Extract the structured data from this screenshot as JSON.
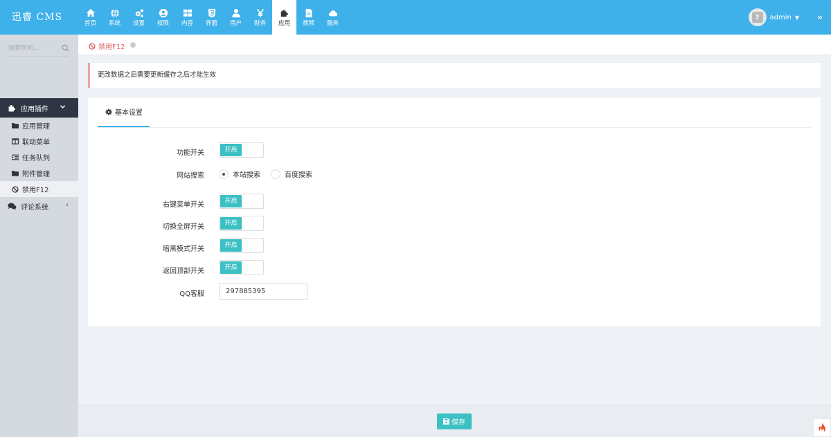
{
  "app": {
    "logo": "迅睿 CMS"
  },
  "topnav": [
    {
      "label": "首页",
      "icon": "home-icon"
    },
    {
      "label": "系统",
      "icon": "globe-icon"
    },
    {
      "label": "设置",
      "icon": "cogs-icon"
    },
    {
      "label": "权限",
      "icon": "user-circle-icon"
    },
    {
      "label": "内容",
      "icon": "table-icon"
    },
    {
      "label": "界面",
      "icon": "html5-icon"
    },
    {
      "label": "用户",
      "icon": "user-icon"
    },
    {
      "label": "财务",
      "icon": "yen-icon"
    },
    {
      "label": "应用",
      "icon": "puzzle-icon",
      "active": true
    },
    {
      "label": "视频",
      "icon": "file-icon"
    },
    {
      "label": "服务",
      "icon": "cloud-icon"
    }
  ],
  "user": {
    "name": "admin"
  },
  "sidebar": {
    "search_placeholder": "搜索帮助...",
    "group": {
      "label": "应用插件"
    },
    "items": [
      {
        "label": "应用管理",
        "icon": "folder-icon"
      },
      {
        "label": "联动菜单",
        "icon": "columns-icon"
      },
      {
        "label": "任务队列",
        "icon": "indent-icon"
      },
      {
        "label": "附件管理",
        "icon": "folder-icon"
      },
      {
        "label": "禁用F12",
        "icon": "ban-icon",
        "active": true
      }
    ],
    "group2": {
      "label": "评论系统"
    }
  },
  "tab": {
    "label": "禁用F12"
  },
  "notice": {
    "text": "更改数据之后需要更新缓存之后才能生效"
  },
  "panel": {
    "tab_label": "基本设置",
    "fields": {
      "func_switch": {
        "label": "功能开关",
        "toggle": "开启"
      },
      "site_search": {
        "label": "网站搜索",
        "options": [
          "本站搜索",
          "百度搜索"
        ],
        "selected": "本站搜索"
      },
      "right_menu": {
        "label": "右键菜单开关",
        "toggle": "开启"
      },
      "fullscreen": {
        "label": "切换全屏开关",
        "toggle": "开启"
      },
      "dark_mode": {
        "label": "暗黑模式开关",
        "toggle": "开启"
      },
      "back_top": {
        "label": "返回顶部开关",
        "toggle": "开启"
      },
      "qq": {
        "label": "QQ客服",
        "value": "297885395"
      }
    }
  },
  "footer": {
    "save_label": "保存"
  },
  "colors": {
    "accent": "#3eb0ea",
    "teal": "#3bc0c3",
    "sidebar": "#d5d9e0",
    "sidebar_active": "#2e3644",
    "danger": "#e05d5d"
  }
}
